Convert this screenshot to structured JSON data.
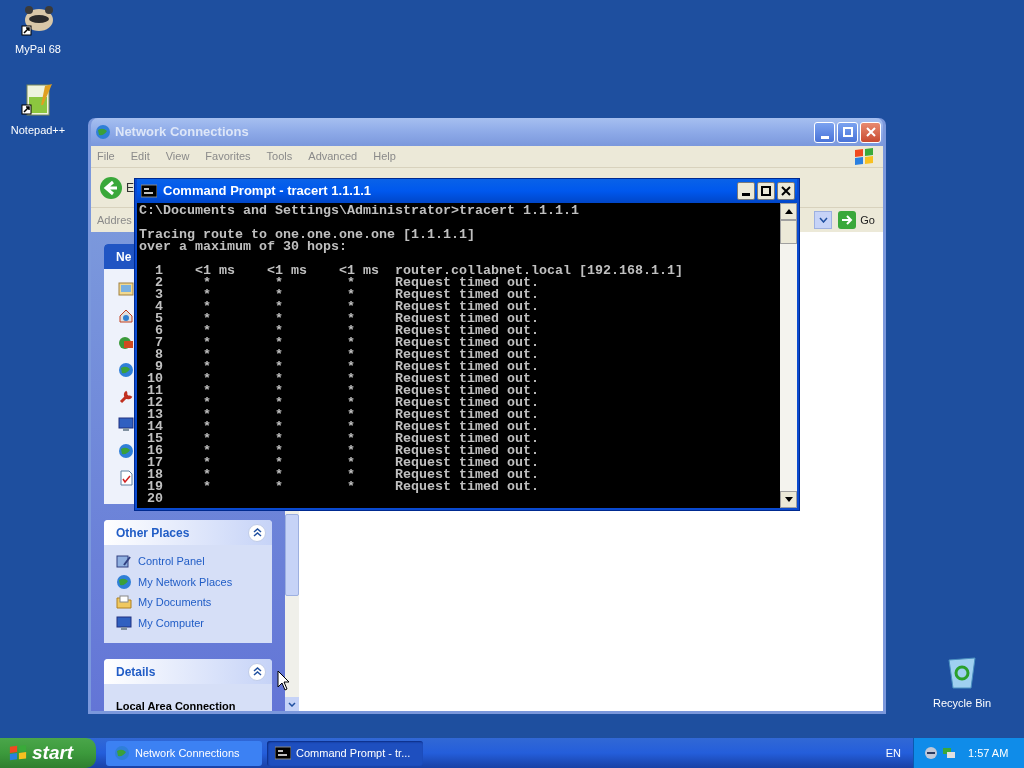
{
  "desktop_icons": [
    {
      "label": "MyPal 68",
      "kind": "animal"
    },
    {
      "label": "Notepad++",
      "kind": "notepad"
    },
    {
      "label": "Recycle Bin",
      "kind": "recycle"
    }
  ],
  "network_window": {
    "title": "Network Connections",
    "active": false,
    "kind": "explorer",
    "menu": [
      "File",
      "Edit",
      "View",
      "Favorites",
      "Tools",
      "Advanced",
      "Help"
    ],
    "back_label": "E",
    "address_label": "Addres",
    "go_label": "Go",
    "task_panels": [
      {
        "title": "Ne",
        "kind": "primary",
        "items": [
          {
            "kind": "image"
          },
          {
            "kind": "home"
          },
          {
            "kind": "firewall"
          },
          {
            "kind": "globe"
          },
          {
            "kind": "wrench"
          },
          {
            "kind": "monitor"
          },
          {
            "kind": "globe"
          },
          {
            "kind": "document"
          }
        ]
      },
      {
        "title": "Other Places",
        "kind": "normal",
        "items": [
          {
            "label": "Control Panel",
            "kind": "control"
          },
          {
            "label": "My Network Places",
            "kind": "globe"
          },
          {
            "label": "My Documents",
            "kind": "folder"
          },
          {
            "label": "My Computer",
            "kind": "monitor"
          }
        ]
      },
      {
        "title": "Details",
        "kind": "details",
        "heading": "Local Area Connection"
      }
    ]
  },
  "cmd_window": {
    "title": "Command Prompt - tracert 1.1.1.1",
    "active": true,
    "kind": "console",
    "blocks": [
      [
        "C:\\Documents and Settings\\Administrator>tracert 1.1.1.1"
      ],
      [
        "Tracing route to one.one.one.one [1.1.1.1]",
        "over a maximum of 30 hops:"
      ],
      [
        "  1    <1 ms    <1 ms    <1 ms  router.collabnet.local [192.168.1.1]",
        "  2     *        *        *     Request timed out.",
        "  3     *        *        *     Request timed out.",
        "  4     *        *        *     Request timed out.",
        "  5     *        *        *     Request timed out.",
        "  6     *        *        *     Request timed out.",
        "  7     *        *        *     Request timed out.",
        "  8     *        *        *     Request timed out.",
        "  9     *        *        *     Request timed out.",
        " 10     *        *        *     Request timed out.",
        " 11     *        *        *     Request timed out.",
        " 12     *        *        *     Request timed out.",
        " 13     *        *        *     Request timed out.",
        " 14     *        *        *     Request timed out.",
        " 15     *        *        *     Request timed out.",
        " 16     *        *        *     Request timed out.",
        " 17     *        *        *     Request timed out.",
        " 18     *        *        *     Request timed out.",
        " 19     *        *        *     Request timed out.",
        " 20"
      ]
    ]
  },
  "taskbar": {
    "start": "start",
    "items": [
      {
        "label": "Network Connections",
        "kind": "network",
        "selected": false
      },
      {
        "label": "Command Prompt - tr...",
        "kind": "console",
        "selected": true
      }
    ],
    "language": "EN",
    "clock": "1:57 AM"
  }
}
